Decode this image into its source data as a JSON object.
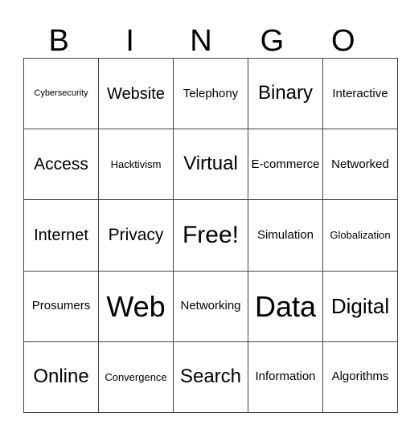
{
  "header": [
    "B",
    "I",
    "N",
    "G",
    "O"
  ],
  "rows": [
    [
      {
        "text": "Cybersecurity",
        "size": "s11"
      },
      {
        "text": "Website",
        "size": "s20"
      },
      {
        "text": "Telephony",
        "size": "s15"
      },
      {
        "text": "Binary",
        "size": "s24"
      },
      {
        "text": "Interactive",
        "size": "s15"
      }
    ],
    [
      {
        "text": "Access",
        "size": "s21"
      },
      {
        "text": "Hacktivism",
        "size": "s13"
      },
      {
        "text": "Virtual",
        "size": "s24"
      },
      {
        "text": "E-commerce",
        "size": "s15"
      },
      {
        "text": "Networked",
        "size": "s15"
      }
    ],
    [
      {
        "text": "Internet",
        "size": "s20"
      },
      {
        "text": "Privacy",
        "size": "s21"
      },
      {
        "text": "Free!",
        "size": "s30"
      },
      {
        "text": "Simulation",
        "size": "s15"
      },
      {
        "text": "Globalization",
        "size": "s13"
      }
    ],
    [
      {
        "text": "Prosumers",
        "size": "s15"
      },
      {
        "text": "Web",
        "size": "s36"
      },
      {
        "text": "Networking",
        "size": "s15"
      },
      {
        "text": "Data",
        "size": "s36"
      },
      {
        "text": "Digital",
        "size": "s26"
      }
    ],
    [
      {
        "text": "Online",
        "size": "s24"
      },
      {
        "text": "Convergence",
        "size": "s13"
      },
      {
        "text": "Search",
        "size": "s24"
      },
      {
        "text": "Information",
        "size": "s15"
      },
      {
        "text": "Algorithms",
        "size": "s15"
      }
    ]
  ]
}
